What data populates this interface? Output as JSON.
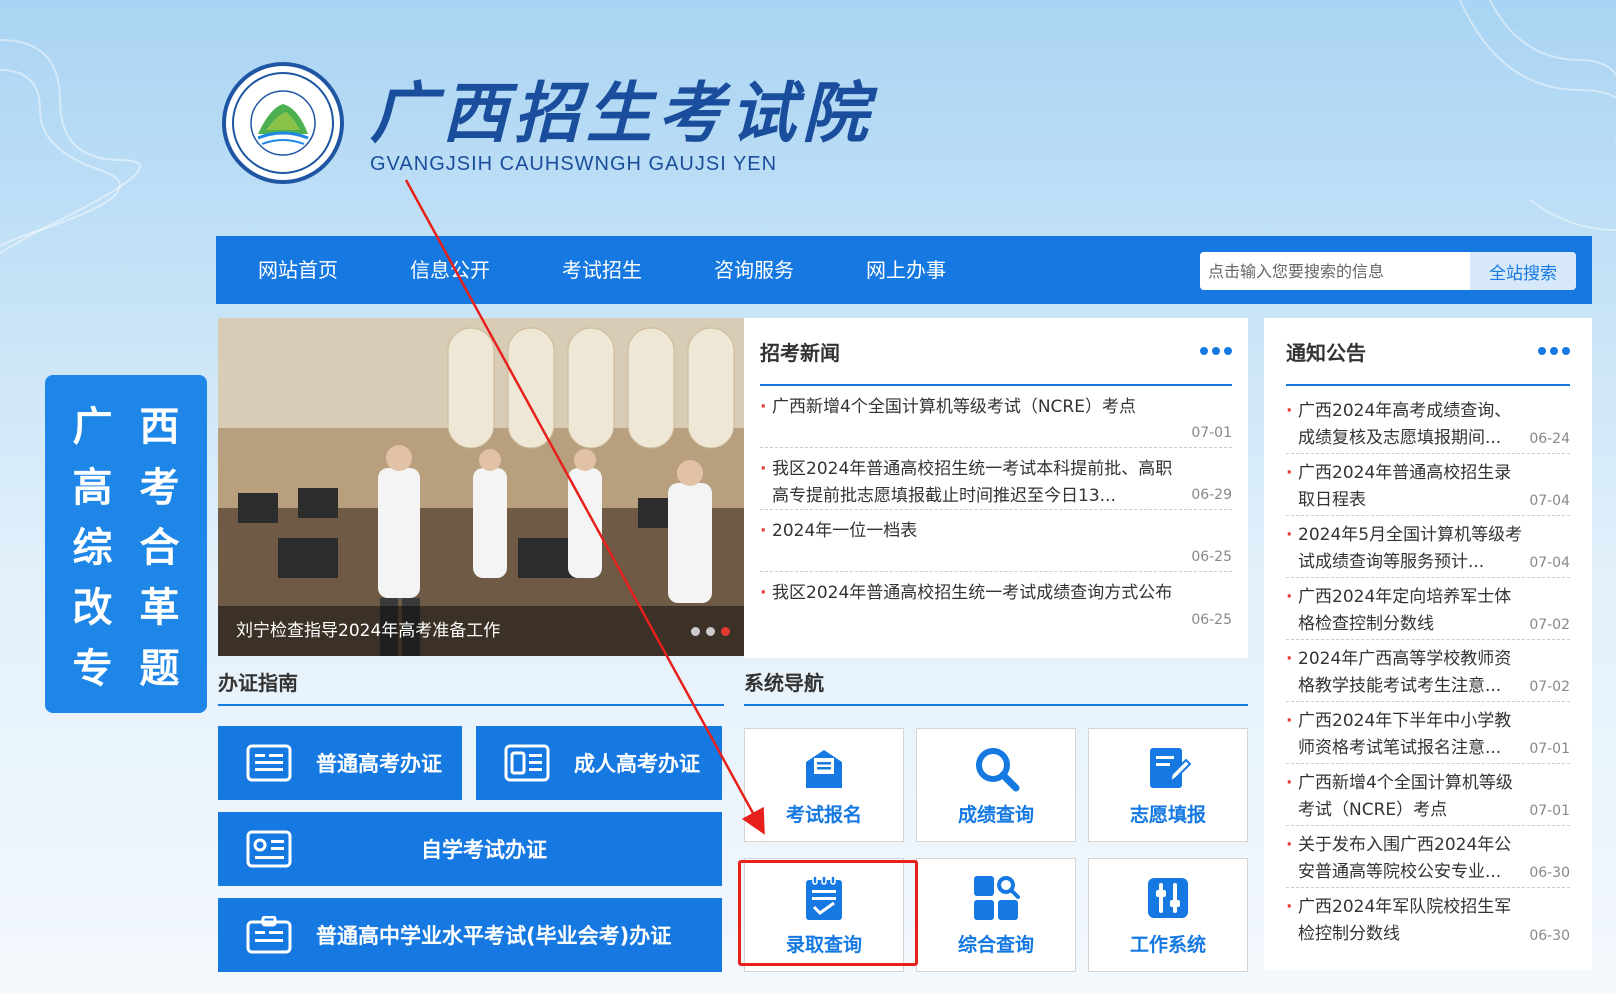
{
  "header": {
    "title": "广西招生考试院",
    "subtitle": "GVANGJSIH CAUHSWNGH GAUJSI YEN",
    "seal_text": "广西招生考试院",
    "seal_subtext": "GVANGJSIH CAUHSWNGH GAUJSIYEN"
  },
  "nav": {
    "items": [
      "网站首页",
      "信息公开",
      "考试招生",
      "咨询服务",
      "网上办事"
    ],
    "search_placeholder": "点击输入您要搜索的信息",
    "search_button": "全站搜索"
  },
  "side_card": {
    "chars": [
      "广",
      "西",
      "高",
      "考",
      "综",
      "合",
      "改",
      "革",
      "专",
      "题"
    ]
  },
  "photo": {
    "caption": "刘宁检查指导2024年高考准备工作"
  },
  "news": {
    "title": "招考新闻",
    "items": [
      {
        "title": "广西新增4个全国计算机等级考试（NCRE）考点",
        "date": "07-01"
      },
      {
        "title": "我区2024年普通高校招生统一考试本科提前批、高职高专提前批志愿填报截止时间推迟至今日13...",
        "date": "06-29"
      },
      {
        "title": "2024年一位一档表",
        "date": "06-25"
      },
      {
        "title": "我区2024年普通高校招生统一考试成绩查询方式公布",
        "date": "06-25"
      }
    ]
  },
  "notices": {
    "title": "通知公告",
    "items": [
      {
        "title": "广西2024年高考成绩查询、成绩复核及志愿填报期间...",
        "date": "06-24"
      },
      {
        "title": "广西2024年普通高校招生录取日程表",
        "date": "07-04"
      },
      {
        "title": "2024年5月全国计算机等级考试成绩查询等服务预计...",
        "date": "07-04"
      },
      {
        "title": "广西2024年定向培养军士体格检查控制分数线",
        "date": "07-02"
      },
      {
        "title": "2024年广西高等学校教师资格教学技能考试考生注意...",
        "date": "07-02"
      },
      {
        "title": "广西2024年下半年中小学教师资格考试笔试报名注意...",
        "date": "07-01"
      },
      {
        "title": "广西新增4个全国计算机等级考试（NCRE）考点",
        "date": "07-01"
      },
      {
        "title": "关于发布入围广西2024年公安普通高等院校公安专业...",
        "date": "06-30"
      },
      {
        "title": "广西2024年军队院校招生军检控制分数线",
        "date": "06-30"
      }
    ]
  },
  "guide": {
    "title": "办证指南",
    "buttons": [
      "普通高考办证",
      "成人高考办证",
      "自学考试办证",
      "普通高中学业水平考试(毕业会考)办证"
    ]
  },
  "system_nav": {
    "title": "系统导航",
    "tiles": [
      {
        "label": "考试报名",
        "icon": "exam-signup-icon"
      },
      {
        "label": "成绩查询",
        "icon": "search-icon"
      },
      {
        "label": "志愿填报",
        "icon": "edit-form-icon"
      },
      {
        "label": "录取查询",
        "icon": "admission-clipboard-icon"
      },
      {
        "label": "综合查询",
        "icon": "grid-search-icon"
      },
      {
        "label": "工作系统",
        "icon": "sliders-icon"
      }
    ]
  },
  "colors": {
    "primary": "#1679e1",
    "annotation_red": "#e8201c",
    "logo_blue": "#1a4e9c"
  }
}
